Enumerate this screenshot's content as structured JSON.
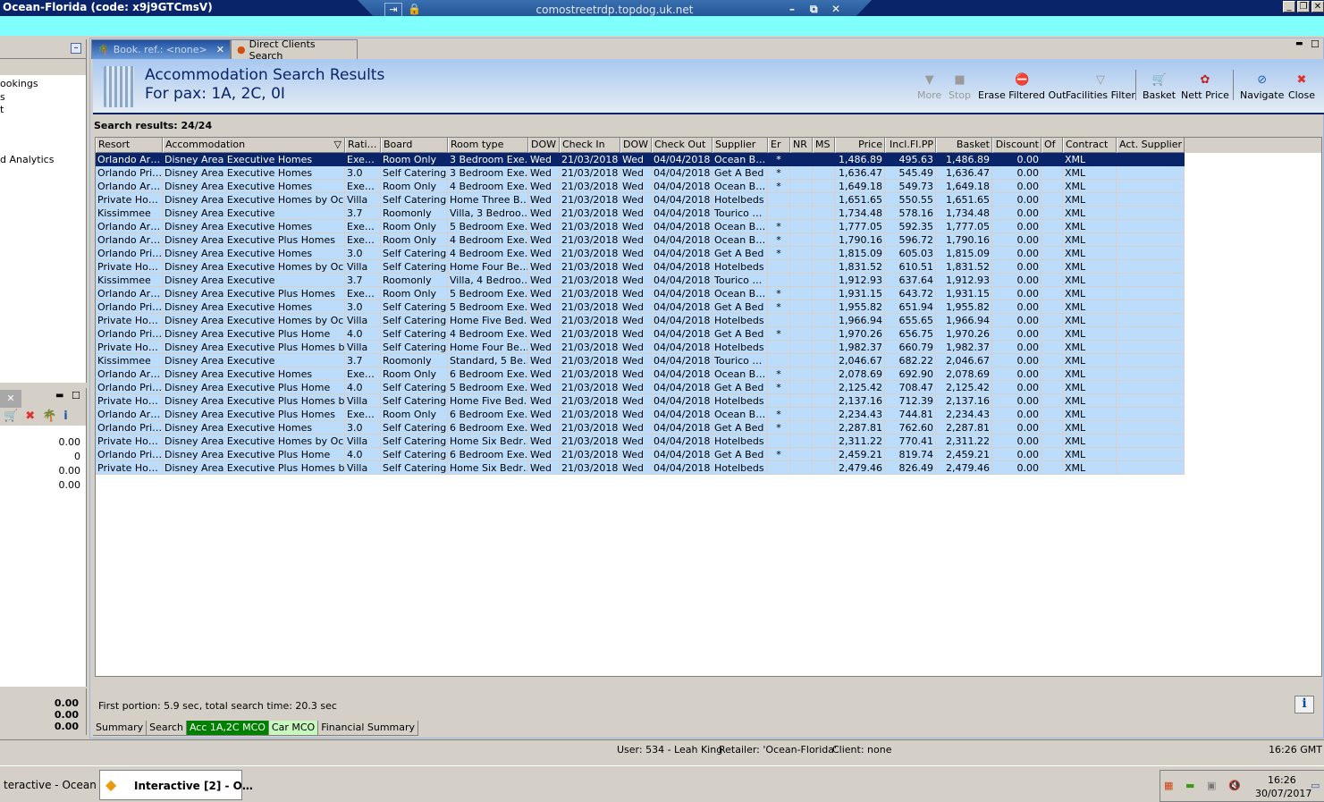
{
  "window": {
    "title": "Ocean-Florida (code: x9j9GTCmsV)",
    "rdp_host": "comostreetrdp.topdog.uk.net"
  },
  "left_panel": {
    "items": [
      "ookings",
      "s",
      "t",
      "d Analytics"
    ],
    "values": [
      "0.00",
      "0",
      "0.00",
      "0.00"
    ],
    "totals": [
      "0.00",
      "0.00",
      "0.00"
    ]
  },
  "tabs": [
    {
      "label": "Book. ref.: <none>"
    },
    {
      "label": "Direct Clients Search"
    }
  ],
  "header": {
    "title": "Accommodation Search Results",
    "subtitle": "For pax: 1A, 2C, 0I"
  },
  "toolbar": [
    {
      "label": "More",
      "icon": "triangle-down-icon",
      "disabled": true
    },
    {
      "label": "Stop",
      "icon": "stop-icon",
      "disabled": true
    },
    {
      "label": "Erase Filtered Out",
      "icon": "erase-filter-icon"
    },
    {
      "label": "Facilities Filter",
      "icon": "funnel-icon"
    },
    {
      "label": "Basket",
      "icon": "basket-icon"
    },
    {
      "label": "Nett Price",
      "icon": "nett-price-icon"
    },
    {
      "label": "Navigate",
      "icon": "compass-icon"
    },
    {
      "label": "Close",
      "icon": "close-icon"
    }
  ],
  "results": {
    "label": "Search results: 24/24"
  },
  "grid": {
    "columns": [
      "Resort",
      "Accommodation",
      "Rati…",
      "Board",
      "Room type",
      "DOW",
      "Check In",
      "DOW",
      "Check Out",
      "Supplier",
      "Er",
      "NR",
      "MS",
      "Price",
      "Incl.Fl.PP",
      "Basket",
      "Discount",
      "Of",
      "Contract",
      "Act. Supplier"
    ],
    "rows": [
      [
        "Orlando Ar…",
        "Disney Area Executive Homes",
        "Exe…",
        "Room Only",
        "3 Bedroom Exe…",
        "Wed",
        "21/03/2018",
        "Wed",
        "04/04/2018",
        "Ocean B…",
        "*",
        "",
        "",
        "1,486.89",
        "495.63",
        "1,486.89",
        "0.00",
        "",
        "XML",
        ""
      ],
      [
        "Orlando Pri…",
        "Disney Area Executive Homes",
        "3.0",
        "Self Catering",
        "3 Bedroom Exe…",
        "Wed",
        "21/03/2018",
        "Wed",
        "04/04/2018",
        "Get A Bed",
        "*",
        "",
        "",
        "1,636.47",
        "545.49",
        "1,636.47",
        "0.00",
        "",
        "XML",
        ""
      ],
      [
        "Orlando Ar…",
        "Disney Area Executive Homes",
        "Exe…",
        "Room Only",
        "4 Bedroom Exe…",
        "Wed",
        "21/03/2018",
        "Wed",
        "04/04/2018",
        "Ocean B…",
        "*",
        "",
        "",
        "1,649.18",
        "549.73",
        "1,649.18",
        "0.00",
        "",
        "XML",
        ""
      ],
      [
        "Private Ho…",
        "Disney Area Executive Homes by Ocea…",
        "Villa",
        "Self Catering",
        "Home Three B…",
        "Wed",
        "21/03/2018",
        "Wed",
        "04/04/2018",
        "Hotelbeds",
        "",
        "",
        "",
        "1,651.65",
        "550.55",
        "1,651.65",
        "0.00",
        "",
        "XML",
        ""
      ],
      [
        "Kissimmee",
        "Disney Area Executive",
        "3.7",
        "Roomonly",
        "Villa, 3 Bedroo…",
        "Wed",
        "21/03/2018",
        "Wed",
        "04/04/2018",
        "Tourico …",
        "",
        "",
        "",
        "1,734.48",
        "578.16",
        "1,734.48",
        "0.00",
        "",
        "XML",
        ""
      ],
      [
        "Orlando Ar…",
        "Disney Area Executive Homes",
        "Exe…",
        "Room Only",
        "5 Bedroom Exe…",
        "Wed",
        "21/03/2018",
        "Wed",
        "04/04/2018",
        "Ocean B…",
        "*",
        "",
        "",
        "1,777.05",
        "592.35",
        "1,777.05",
        "0.00",
        "",
        "XML",
        ""
      ],
      [
        "Orlando Ar…",
        "Disney Area Executive Plus Homes",
        "Exe…",
        "Room Only",
        "4 Bedroom Exe…",
        "Wed",
        "21/03/2018",
        "Wed",
        "04/04/2018",
        "Ocean B…",
        "*",
        "",
        "",
        "1,790.16",
        "596.72",
        "1,790.16",
        "0.00",
        "",
        "XML",
        ""
      ],
      [
        "Orlando Pri…",
        "Disney Area Executive Homes",
        "3.0",
        "Self Catering",
        "4 Bedroom Exe…",
        "Wed",
        "21/03/2018",
        "Wed",
        "04/04/2018",
        "Get A Bed",
        "*",
        "",
        "",
        "1,815.09",
        "605.03",
        "1,815.09",
        "0.00",
        "",
        "XML",
        ""
      ],
      [
        "Private Ho…",
        "Disney Area Executive Homes by Ocea…",
        "Villa",
        "Self Catering",
        "Home Four Be…",
        "Wed",
        "21/03/2018",
        "Wed",
        "04/04/2018",
        "Hotelbeds",
        "",
        "",
        "",
        "1,831.52",
        "610.51",
        "1,831.52",
        "0.00",
        "",
        "XML",
        ""
      ],
      [
        "Kissimmee",
        "Disney Area Executive",
        "3.7",
        "Roomonly",
        "Villa, 4 Bedroo…",
        "Wed",
        "21/03/2018",
        "Wed",
        "04/04/2018",
        "Tourico …",
        "",
        "",
        "",
        "1,912.93",
        "637.64",
        "1,912.93",
        "0.00",
        "",
        "XML",
        ""
      ],
      [
        "Orlando Ar…",
        "Disney Area Executive Plus Homes",
        "Exe…",
        "Room Only",
        "5 Bedroom Exe…",
        "Wed",
        "21/03/2018",
        "Wed",
        "04/04/2018",
        "Ocean B…",
        "*",
        "",
        "",
        "1,931.15",
        "643.72",
        "1,931.15",
        "0.00",
        "",
        "XML",
        ""
      ],
      [
        "Orlando Pri…",
        "Disney Area Executive Homes",
        "3.0",
        "Self Catering",
        "5 Bedroom Exe…",
        "Wed",
        "21/03/2018",
        "Wed",
        "04/04/2018",
        "Get A Bed",
        "*",
        "",
        "",
        "1,955.82",
        "651.94",
        "1,955.82",
        "0.00",
        "",
        "XML",
        ""
      ],
      [
        "Private Ho…",
        "Disney Area Executive Homes by Ocea…",
        "Villa",
        "Self Catering",
        "Home Five Bed…",
        "Wed",
        "21/03/2018",
        "Wed",
        "04/04/2018",
        "Hotelbeds",
        "",
        "",
        "",
        "1,966.94",
        "655.65",
        "1,966.94",
        "0.00",
        "",
        "XML",
        ""
      ],
      [
        "Orlando Pri…",
        "Disney Area Executive Plus Home",
        "4.0",
        "Self Catering",
        "4 Bedroom Exe…",
        "Wed",
        "21/03/2018",
        "Wed",
        "04/04/2018",
        "Get A Bed",
        "*",
        "",
        "",
        "1,970.26",
        "656.75",
        "1,970.26",
        "0.00",
        "",
        "XML",
        ""
      ],
      [
        "Private Ho…",
        "Disney Area Executive Plus Homes by …",
        "Villa",
        "Self Catering",
        "Home Four Be…",
        "Wed",
        "21/03/2018",
        "Wed",
        "04/04/2018",
        "Hotelbeds",
        "",
        "",
        "",
        "1,982.37",
        "660.79",
        "1,982.37",
        "0.00",
        "",
        "XML",
        ""
      ],
      [
        "Kissimmee",
        "Disney Area Executive",
        "3.7",
        "Roomonly",
        "Standard, 5 Be…",
        "Wed",
        "21/03/2018",
        "Wed",
        "04/04/2018",
        "Tourico …",
        "",
        "",
        "",
        "2,046.67",
        "682.22",
        "2,046.67",
        "0.00",
        "",
        "XML",
        ""
      ],
      [
        "Orlando Ar…",
        "Disney Area Executive Homes",
        "Exe…",
        "Room Only",
        "6 Bedroom Exe…",
        "Wed",
        "21/03/2018",
        "Wed",
        "04/04/2018",
        "Ocean B…",
        "*",
        "",
        "",
        "2,078.69",
        "692.90",
        "2,078.69",
        "0.00",
        "",
        "XML",
        ""
      ],
      [
        "Orlando Pri…",
        "Disney Area Executive Plus Home",
        "4.0",
        "Self Catering",
        "5 Bedroom Exe…",
        "Wed",
        "21/03/2018",
        "Wed",
        "04/04/2018",
        "Get A Bed",
        "*",
        "",
        "",
        "2,125.42",
        "708.47",
        "2,125.42",
        "0.00",
        "",
        "XML",
        ""
      ],
      [
        "Private Ho…",
        "Disney Area Executive Plus Homes by …",
        "Villa",
        "Self Catering",
        "Home Five Bed…",
        "Wed",
        "21/03/2018",
        "Wed",
        "04/04/2018",
        "Hotelbeds",
        "",
        "",
        "",
        "2,137.16",
        "712.39",
        "2,137.16",
        "0.00",
        "",
        "XML",
        ""
      ],
      [
        "Orlando Ar…",
        "Disney Area Executive Plus Homes",
        "Exe…",
        "Room Only",
        "6 Bedroom Exe…",
        "Wed",
        "21/03/2018",
        "Wed",
        "04/04/2018",
        "Ocean B…",
        "*",
        "",
        "",
        "2,234.43",
        "744.81",
        "2,234.43",
        "0.00",
        "",
        "XML",
        ""
      ],
      [
        "Orlando Pri…",
        "Disney Area Executive Homes",
        "3.0",
        "Self Catering",
        "6 Bedroom Exe…",
        "Wed",
        "21/03/2018",
        "Wed",
        "04/04/2018",
        "Get A Bed",
        "*",
        "",
        "",
        "2,287.81",
        "762.60",
        "2,287.81",
        "0.00",
        "",
        "XML",
        ""
      ],
      [
        "Private Ho…",
        "Disney Area Executive Homes by Ocea…",
        "Villa",
        "Self Catering",
        "Home Six Bedr…",
        "Wed",
        "21/03/2018",
        "Wed",
        "04/04/2018",
        "Hotelbeds",
        "",
        "",
        "",
        "2,311.22",
        "770.41",
        "2,311.22",
        "0.00",
        "",
        "XML",
        ""
      ],
      [
        "Orlando Pri…",
        "Disney Area Executive Plus Home",
        "4.0",
        "Self Catering",
        "6 Bedroom Exe…",
        "Wed",
        "21/03/2018",
        "Wed",
        "04/04/2018",
        "Get A Bed",
        "*",
        "",
        "",
        "2,459.21",
        "819.74",
        "2,459.21",
        "0.00",
        "",
        "XML",
        ""
      ],
      [
        "Private Ho…",
        "Disney Area Executive Plus Homes by …",
        "Villa",
        "Self Catering",
        "Home Six Bedr…",
        "Wed",
        "21/03/2018",
        "Wed",
        "04/04/2018",
        "Hotelbeds",
        "",
        "",
        "",
        "2,479.46",
        "826.49",
        "2,479.46",
        "0.00",
        "",
        "XML",
        ""
      ]
    ]
  },
  "footer": {
    "timing": "First portion: 5.9 sec, total search time: 20.3 sec",
    "tabs": [
      "Summary",
      "Search",
      "Acc 1A,2C MCO",
      "Car MCO",
      "Financial Summary"
    ]
  },
  "status": {
    "user": "User: 534 - Leah King",
    "retailer": "Retailer: 'Ocean-Florida'",
    "client": "Client: none",
    "time": "16:26 GMT"
  },
  "taskbar": {
    "tasks": [
      "teractive - Ocean-F…",
      "Interactive [2] - O…"
    ],
    "clock_time": "16:26",
    "clock_date": "30/07/2017"
  },
  "colors": {
    "selection": "#0a246a",
    "row": "#bcdcfc",
    "active_tab": "#008000",
    "car_tab": "#c8f8c0"
  }
}
